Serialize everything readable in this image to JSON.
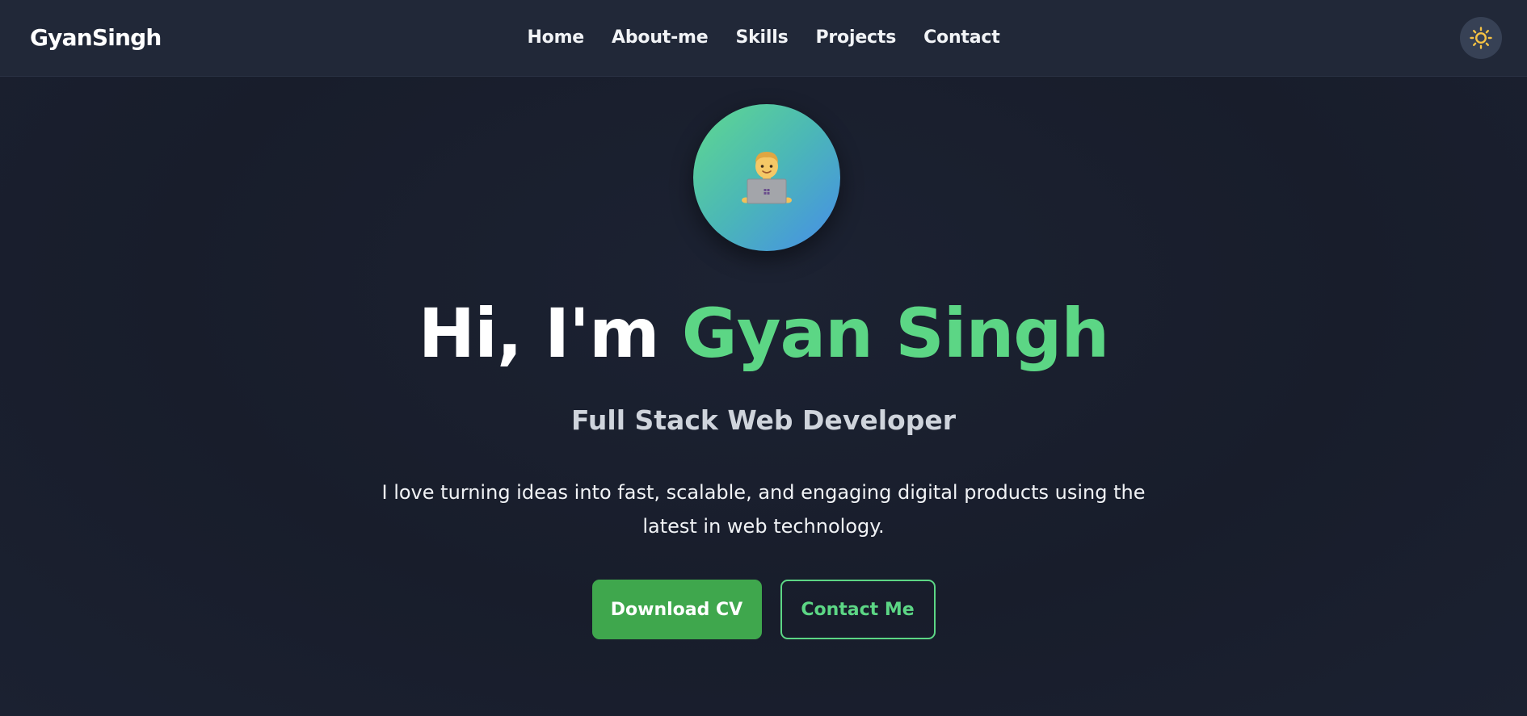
{
  "navbar": {
    "brand": "GyanSingh",
    "links": [
      {
        "label": "Home"
      },
      {
        "label": "About-me"
      },
      {
        "label": "Skills"
      },
      {
        "label": "Projects"
      },
      {
        "label": "Contact"
      }
    ],
    "theme_toggle_icon": "sun-icon"
  },
  "hero": {
    "avatar_icon": "technologist-emoji",
    "greeting": "Hi, I'm",
    "name": "Gyan Singh",
    "subtitle": "Full Stack Web Developer",
    "description": "I love turning ideas into fast, scalable, and engaging digital products using the latest in web technology.",
    "buttons": {
      "download_cv": "Download CV",
      "contact_me": "Contact Me"
    }
  },
  "colors": {
    "accent": "#5cd685",
    "primary_button": "#3fa74d",
    "background": "#1a1f2d",
    "navbar": "#212838",
    "sun": "#f6c244"
  }
}
